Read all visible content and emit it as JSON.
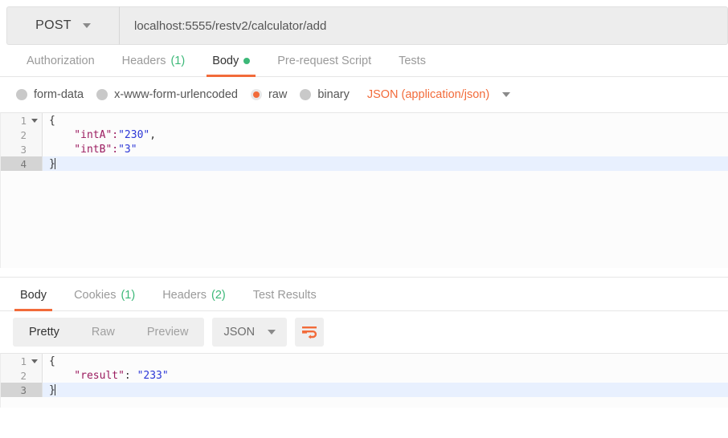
{
  "request": {
    "method": "POST",
    "method_caret_icon": "chevron-down-icon",
    "url": "localhost:5555/restv2/calculator/add",
    "tabs": [
      {
        "label": "Authorization",
        "count": "",
        "active": false,
        "dot": false
      },
      {
        "label": "Headers",
        "count": "(1)",
        "active": false,
        "dot": false
      },
      {
        "label": "Body",
        "count": "",
        "active": true,
        "dot": true
      },
      {
        "label": "Pre-request Script",
        "count": "",
        "active": false,
        "dot": false
      },
      {
        "label": "Tests",
        "count": "",
        "active": false,
        "dot": false
      }
    ],
    "body_types": [
      {
        "label": "form-data",
        "checked": false
      },
      {
        "label": "x-www-form-urlencoded",
        "checked": false
      },
      {
        "label": "raw",
        "checked": true
      },
      {
        "label": "binary",
        "checked": false
      }
    ],
    "content_type": "JSON (application/json)",
    "content_type_caret_icon": "chevron-down-icon",
    "editor": {
      "lines": [
        {
          "num": "1",
          "fold": true,
          "active": false,
          "tokens": [
            {
              "t": "punct",
              "v": "{"
            }
          ],
          "caret": false
        },
        {
          "num": "2",
          "fold": false,
          "active": false,
          "tokens": [
            {
              "t": "key",
              "v": "    \"intA\":"
            },
            {
              "t": "str",
              "v": "\"230\""
            },
            {
              "t": "punct",
              "v": ","
            }
          ],
          "caret": false
        },
        {
          "num": "3",
          "fold": false,
          "active": false,
          "tokens": [
            {
              "t": "key",
              "v": "    \"intB\":"
            },
            {
              "t": "str",
              "v": "\"3\""
            }
          ],
          "caret": false
        },
        {
          "num": "4",
          "fold": false,
          "active": true,
          "tokens": [
            {
              "t": "punct",
              "v": "}"
            }
          ],
          "caret": true
        }
      ]
    }
  },
  "response": {
    "tabs": [
      {
        "label": "Body",
        "count": "",
        "active": true
      },
      {
        "label": "Cookies",
        "count": "(1)",
        "active": false
      },
      {
        "label": "Headers",
        "count": "(2)",
        "active": false
      },
      {
        "label": "Test Results",
        "count": "",
        "active": false
      }
    ],
    "view_modes": [
      {
        "label": "Pretty",
        "active": true
      },
      {
        "label": "Raw",
        "active": false
      },
      {
        "label": "Preview",
        "active": false
      }
    ],
    "format": "JSON",
    "format_caret_icon": "chevron-down-icon",
    "wrap_icon": "word-wrap-icon",
    "editor": {
      "lines": [
        {
          "num": "1",
          "fold": true,
          "active": false,
          "tokens": [
            {
              "t": "punct",
              "v": "{"
            }
          ],
          "caret": false
        },
        {
          "num": "2",
          "fold": false,
          "active": false,
          "tokens": [
            {
              "t": "key",
              "v": "    \"result\""
            },
            {
              "t": "punct",
              "v": ": "
            },
            {
              "t": "str",
              "v": "\"233\""
            }
          ],
          "caret": false
        },
        {
          "num": "3",
          "fold": false,
          "active": true,
          "tokens": [
            {
              "t": "punct",
              "v": "}"
            }
          ],
          "caret": true
        }
      ]
    }
  },
  "colors": {
    "accent": "#f26b3a",
    "success": "#3cb878",
    "json_key": "#9b1b5f",
    "json_string": "#2b36d6",
    "active_line": "#e8f0fe"
  }
}
